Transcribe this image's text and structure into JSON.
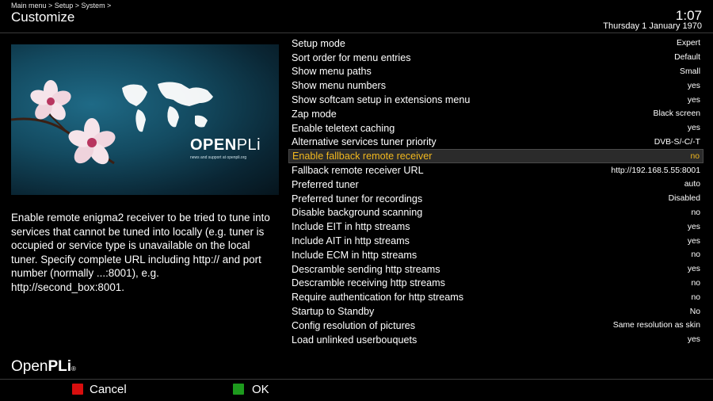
{
  "header": {
    "breadcrumb": "Main menu > Setup > System >",
    "title": "Customize",
    "time": "1:07",
    "date": "Thursday  1 January 1970"
  },
  "preview": {
    "brand_bold": "OPEN",
    "brand_thin": "PLi",
    "brand_sub": "news and support at openpli.org"
  },
  "help_text": "Enable remote enigma2 receiver to be tried to tune into services that cannot be tuned into locally (e.g. tuner is occupied or service type is unavailable on the local tuner. Specify complete URL including http:// and port number (normally ...:8001), e.g. http://second_box:8001.",
  "footer": {
    "logo_thin": "Open",
    "logo_bold": "PLi",
    "logo_mark": "®"
  },
  "buttons": {
    "cancel": "Cancel",
    "ok": "OK"
  },
  "colors": {
    "selected_text": "#f2b81e",
    "red_key": "#d80e0e",
    "green_key": "#1d9a1d"
  },
  "config_items": [
    {
      "label": "Setup mode",
      "value": "Expert"
    },
    {
      "label": "Sort order for menu entries",
      "value": "Default"
    },
    {
      "label": "Show menu paths",
      "value": "Small"
    },
    {
      "label": "Show menu numbers",
      "value": "yes"
    },
    {
      "label": "Show softcam setup in extensions menu",
      "value": "yes"
    },
    {
      "label": "Zap mode",
      "value": "Black screen"
    },
    {
      "label": "Enable teletext caching",
      "value": "yes"
    },
    {
      "label": "Alternative services tuner priority",
      "value": "DVB-S/-C/-T"
    },
    {
      "label": "Enable fallback remote receiver",
      "value": "no"
    },
    {
      "label": "Fallback remote receiver URL",
      "value": "http://192.168.5.55:8001"
    },
    {
      "label": "Preferred tuner",
      "value": "auto"
    },
    {
      "label": "Preferred tuner for recordings",
      "value": "Disabled"
    },
    {
      "label": "Disable background scanning",
      "value": "no"
    },
    {
      "label": "Include EIT in http streams",
      "value": "yes"
    },
    {
      "label": "Include AIT in http streams",
      "value": "yes"
    },
    {
      "label": "Include ECM in http streams",
      "value": "no"
    },
    {
      "label": "Descramble sending http streams",
      "value": "yes"
    },
    {
      "label": "Descramble receiving http streams",
      "value": "no"
    },
    {
      "label": "Require authentication for http streams",
      "value": "no"
    },
    {
      "label": "Startup to Standby",
      "value": "No"
    },
    {
      "label": "Config resolution of pictures",
      "value": "Same resolution as skin"
    },
    {
      "label": "Load unlinked userbouquets",
      "value": "yes"
    }
  ],
  "selected_index": 8
}
